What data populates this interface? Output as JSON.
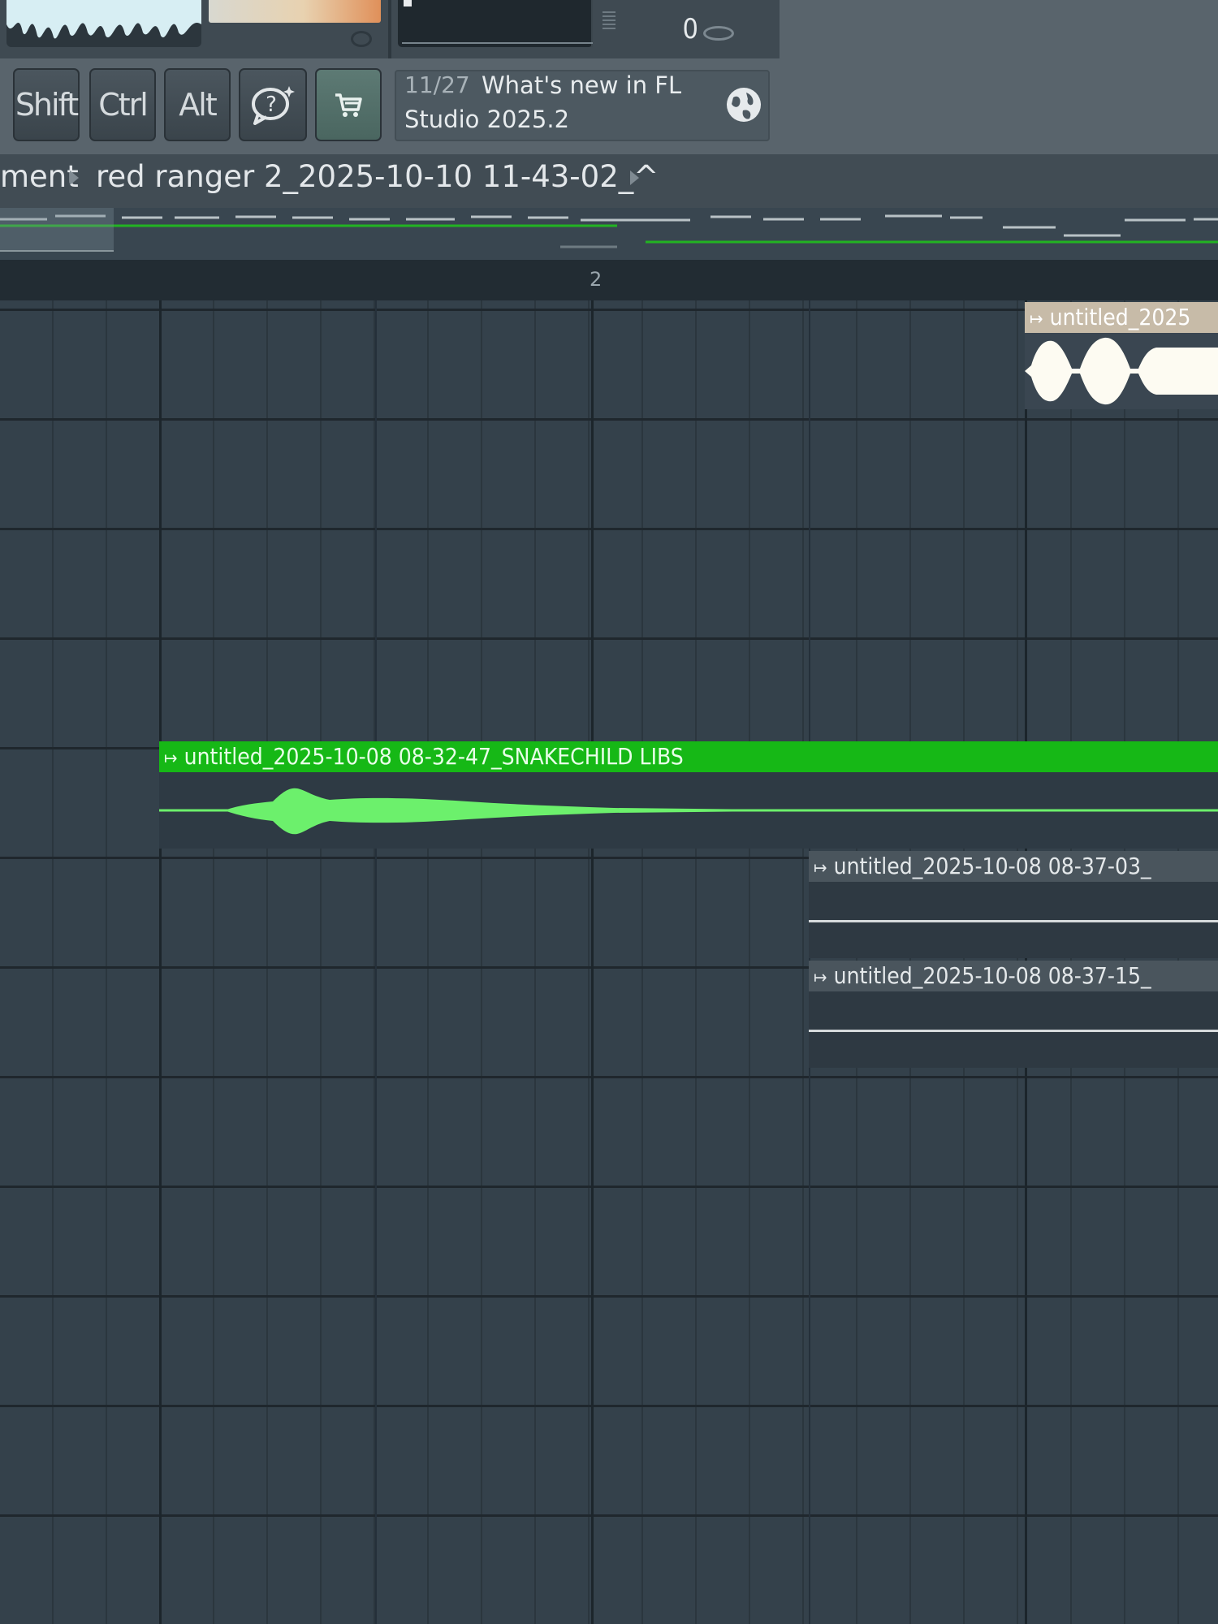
{
  "toolbar": {
    "shift_label": "Shift",
    "ctrl_label": "Ctrl",
    "alt_label": "Alt",
    "help_icon": "help-speech-bubble-icon",
    "store_icon": "shopping-cart-icon",
    "meter_value": "0"
  },
  "news": {
    "count": "11/27",
    "line1": "What's new in FL",
    "line2": "Studio 2025.2",
    "icon": "globe-icon"
  },
  "breadcrumb": {
    "item1": "ment",
    "item2": "red ranger 2_2025-10-10 11-43-02_^"
  },
  "ruler": {
    "mark": "2"
  },
  "clips": {
    "a": {
      "name": "untitled_2025",
      "color": "#c7bba8"
    },
    "b": {
      "name": "untitled_2025-10-08 08-32-47_SNAKECHILD LIBS",
      "color": "#16b816"
    },
    "c": {
      "name": "untitled_2025-10-08 08-37-03_",
      "color": "#4a555d"
    },
    "d": {
      "name": "untitled_2025-10-08 08-37-15_",
      "color": "#4a555d"
    }
  },
  "colors": {
    "grid_background": "#34414b",
    "active_clip_green": "#16b816",
    "waveform_green": "#6cf06c"
  }
}
